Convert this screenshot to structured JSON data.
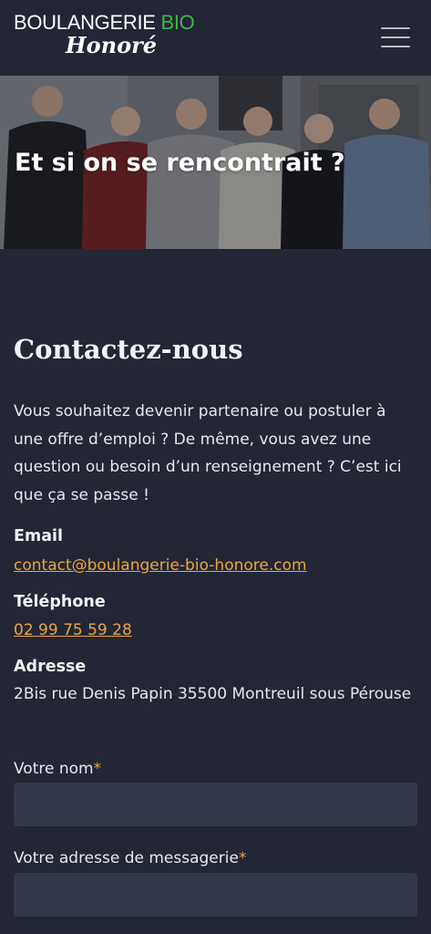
{
  "header": {
    "brand_line1": "BOULANGERIE",
    "brand_bio": "BIO",
    "brand_line2": "Honoré",
    "menu_icon": "hamburger-menu-icon"
  },
  "hero": {
    "title": "Et si on se rencontrait ?"
  },
  "contact": {
    "title": "Contactez-nous",
    "intro": "Vous souhaitez devenir partenaire ou postuler à une offre d’emploi ? De même, vous avez une question ou besoin d’un renseignement ? C’est ici que ça se passe !",
    "email_label": "Email",
    "email_value": "contact@boulangerie-bio-honore.com",
    "phone_label": "Téléphone",
    "phone_value": "02 99 75 59 28",
    "address_label": "Adresse",
    "address_value": "2Bis rue Denis Papin 35500 Montreuil sous Pérouse"
  },
  "form": {
    "name_label": "Votre nom",
    "email_label": "Votre adresse de messagerie",
    "required_mark": "*",
    "name_value": "",
    "email_value": ""
  },
  "colors": {
    "background": "#232634",
    "accent": "#e8a540",
    "brand_green": "#3fb54a",
    "input_bg": "#33374a"
  }
}
